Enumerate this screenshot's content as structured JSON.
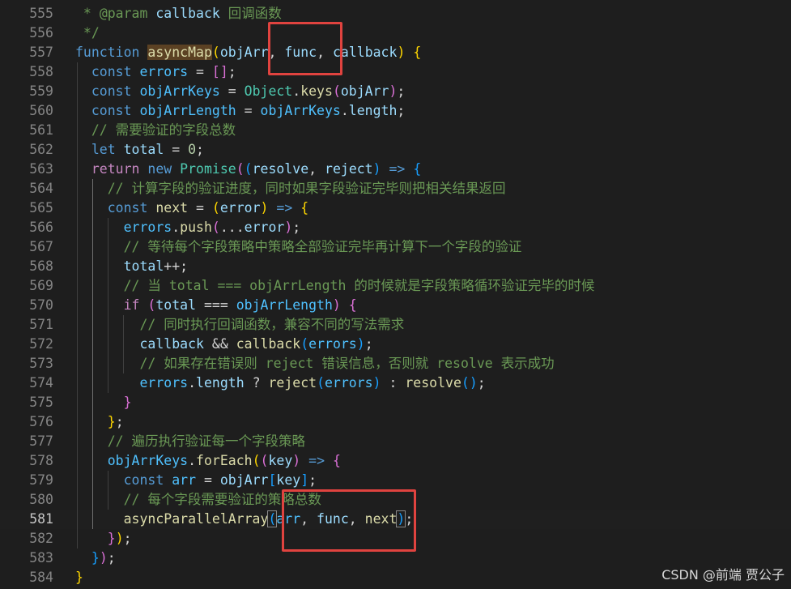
{
  "editor": {
    "lines": [
      {
        "n": "555",
        "tokens": [
          {
            "c": "cm",
            "t": " * "
          },
          {
            "c": "cm",
            "t": "@param"
          },
          {
            "c": "v",
            "t": " callback"
          },
          {
            "c": "cm",
            "t": " 回调函数"
          }
        ]
      },
      {
        "n": "556",
        "tokens": [
          {
            "c": "cm",
            "t": " */"
          }
        ]
      },
      {
        "n": "557",
        "tokens": [
          {
            "c": "k",
            "t": "function"
          },
          {
            "c": "p",
            "t": " "
          },
          {
            "c": "f hl",
            "t": "asyncMap"
          },
          {
            "c": "b1",
            "t": "("
          },
          {
            "c": "v",
            "t": "objArr"
          },
          {
            "c": "p",
            "t": ", "
          },
          {
            "c": "v",
            "t": "func"
          },
          {
            "c": "p",
            "t": ", "
          },
          {
            "c": "v",
            "t": "callback"
          },
          {
            "c": "b1",
            "t": ")"
          },
          {
            "c": "p",
            "t": " "
          },
          {
            "c": "b1",
            "t": "{"
          }
        ]
      },
      {
        "n": "558",
        "tokens": [
          {
            "c": "p",
            "t": "  "
          },
          {
            "c": "k",
            "t": "const"
          },
          {
            "c": "p",
            "t": " "
          },
          {
            "c": "cn",
            "t": "errors"
          },
          {
            "c": "p",
            "t": " = "
          },
          {
            "c": "b2",
            "t": "[]"
          },
          {
            "c": "p",
            "t": ";"
          }
        ]
      },
      {
        "n": "559",
        "tokens": [
          {
            "c": "p",
            "t": "  "
          },
          {
            "c": "k",
            "t": "const"
          },
          {
            "c": "p",
            "t": " "
          },
          {
            "c": "cn",
            "t": "objArrKeys"
          },
          {
            "c": "p",
            "t": " = "
          },
          {
            "c": "t",
            "t": "Object"
          },
          {
            "c": "p",
            "t": "."
          },
          {
            "c": "f",
            "t": "keys"
          },
          {
            "c": "b2",
            "t": "("
          },
          {
            "c": "v",
            "t": "objArr"
          },
          {
            "c": "b2",
            "t": ")"
          },
          {
            "c": "p",
            "t": ";"
          }
        ]
      },
      {
        "n": "560",
        "tokens": [
          {
            "c": "p",
            "t": "  "
          },
          {
            "c": "k",
            "t": "const"
          },
          {
            "c": "p",
            "t": " "
          },
          {
            "c": "cn",
            "t": "objArrLength"
          },
          {
            "c": "p",
            "t": " = "
          },
          {
            "c": "cn",
            "t": "objArrKeys"
          },
          {
            "c": "p",
            "t": "."
          },
          {
            "c": "v",
            "t": "length"
          },
          {
            "c": "p",
            "t": ";"
          }
        ]
      },
      {
        "n": "561",
        "tokens": [
          {
            "c": "p",
            "t": "  "
          },
          {
            "c": "cm",
            "t": "// 需要验证的字段总数"
          }
        ]
      },
      {
        "n": "562",
        "tokens": [
          {
            "c": "p",
            "t": "  "
          },
          {
            "c": "k",
            "t": "let"
          },
          {
            "c": "p",
            "t": " "
          },
          {
            "c": "v",
            "t": "total"
          },
          {
            "c": "p",
            "t": " = "
          },
          {
            "c": "n",
            "t": "0"
          },
          {
            "c": "p",
            "t": ";"
          }
        ]
      },
      {
        "n": "563",
        "tokens": [
          {
            "c": "p",
            "t": "  "
          },
          {
            "c": "c",
            "t": "return"
          },
          {
            "c": "p",
            "t": " "
          },
          {
            "c": "k",
            "t": "new"
          },
          {
            "c": "p",
            "t": " "
          },
          {
            "c": "t",
            "t": "Promise"
          },
          {
            "c": "b2",
            "t": "("
          },
          {
            "c": "b3",
            "t": "("
          },
          {
            "c": "v",
            "t": "resolve"
          },
          {
            "c": "p",
            "t": ", "
          },
          {
            "c": "v",
            "t": "reject"
          },
          {
            "c": "b3",
            "t": ")"
          },
          {
            "c": "p",
            "t": " "
          },
          {
            "c": "k",
            "t": "=>"
          },
          {
            "c": "p",
            "t": " "
          },
          {
            "c": "b3",
            "t": "{"
          }
        ]
      },
      {
        "n": "564",
        "tokens": [
          {
            "c": "p",
            "t": "    "
          },
          {
            "c": "cm",
            "t": "// 计算字段的验证进度，同时如果字段验证完毕则把相关结果返回"
          }
        ]
      },
      {
        "n": "565",
        "tokens": [
          {
            "c": "p",
            "t": "    "
          },
          {
            "c": "k",
            "t": "const"
          },
          {
            "c": "p",
            "t": " "
          },
          {
            "c": "f",
            "t": "next"
          },
          {
            "c": "p",
            "t": " = "
          },
          {
            "c": "b1",
            "t": "("
          },
          {
            "c": "v",
            "t": "error"
          },
          {
            "c": "b1",
            "t": ")"
          },
          {
            "c": "p",
            "t": " "
          },
          {
            "c": "k",
            "t": "=>"
          },
          {
            "c": "p",
            "t": " "
          },
          {
            "c": "b1",
            "t": "{"
          }
        ]
      },
      {
        "n": "566",
        "tokens": [
          {
            "c": "p",
            "t": "      "
          },
          {
            "c": "cn",
            "t": "errors"
          },
          {
            "c": "p",
            "t": "."
          },
          {
            "c": "f",
            "t": "push"
          },
          {
            "c": "b2",
            "t": "("
          },
          {
            "c": "p",
            "t": "..."
          },
          {
            "c": "v",
            "t": "error"
          },
          {
            "c": "b2",
            "t": ")"
          },
          {
            "c": "p",
            "t": ";"
          }
        ]
      },
      {
        "n": "567",
        "tokens": [
          {
            "c": "p",
            "t": "      "
          },
          {
            "c": "cm",
            "t": "// 等待每个字段策略中策略全部验证完毕再计算下一个字段的验证"
          }
        ]
      },
      {
        "n": "568",
        "tokens": [
          {
            "c": "p",
            "t": "      "
          },
          {
            "c": "v",
            "t": "total"
          },
          {
            "c": "p",
            "t": "++;"
          }
        ]
      },
      {
        "n": "569",
        "tokens": [
          {
            "c": "p",
            "t": "      "
          },
          {
            "c": "cm",
            "t": "// 当 total === objArrLength 的时候就是字段策略循环验证完毕的时候"
          }
        ]
      },
      {
        "n": "570",
        "tokens": [
          {
            "c": "p",
            "t": "      "
          },
          {
            "c": "c",
            "t": "if"
          },
          {
            "c": "p",
            "t": " "
          },
          {
            "c": "b2",
            "t": "("
          },
          {
            "c": "v",
            "t": "total"
          },
          {
            "c": "p",
            "t": " === "
          },
          {
            "c": "cn",
            "t": "objArrLength"
          },
          {
            "c": "b2",
            "t": ")"
          },
          {
            "c": "p",
            "t": " "
          },
          {
            "c": "b2",
            "t": "{"
          }
        ]
      },
      {
        "n": "571",
        "tokens": [
          {
            "c": "p",
            "t": "        "
          },
          {
            "c": "cm",
            "t": "// 同时执行回调函数，兼容不同的写法需求"
          }
        ]
      },
      {
        "n": "572",
        "tokens": [
          {
            "c": "p",
            "t": "        "
          },
          {
            "c": "v",
            "t": "callback"
          },
          {
            "c": "p",
            "t": " && "
          },
          {
            "c": "f",
            "t": "callback"
          },
          {
            "c": "b3",
            "t": "("
          },
          {
            "c": "cn",
            "t": "errors"
          },
          {
            "c": "b3",
            "t": ")"
          },
          {
            "c": "p",
            "t": ";"
          }
        ]
      },
      {
        "n": "573",
        "tokens": [
          {
            "c": "p",
            "t": "        "
          },
          {
            "c": "cm",
            "t": "// 如果存在错误则 reject 错误信息，否则就 resolve 表示成功"
          }
        ]
      },
      {
        "n": "574",
        "tokens": [
          {
            "c": "p",
            "t": "        "
          },
          {
            "c": "cn",
            "t": "errors"
          },
          {
            "c": "p",
            "t": "."
          },
          {
            "c": "v",
            "t": "length"
          },
          {
            "c": "p",
            "t": " ? "
          },
          {
            "c": "f",
            "t": "reject"
          },
          {
            "c": "b3",
            "t": "("
          },
          {
            "c": "cn",
            "t": "errors"
          },
          {
            "c": "b3",
            "t": ")"
          },
          {
            "c": "p",
            "t": " : "
          },
          {
            "c": "f",
            "t": "resolve"
          },
          {
            "c": "b3",
            "t": "()"
          },
          {
            "c": "p",
            "t": ";"
          }
        ]
      },
      {
        "n": "575",
        "tokens": [
          {
            "c": "p",
            "t": "      "
          },
          {
            "c": "b2",
            "t": "}"
          }
        ]
      },
      {
        "n": "576",
        "tokens": [
          {
            "c": "p",
            "t": "    "
          },
          {
            "c": "b1",
            "t": "}"
          },
          {
            "c": "p",
            "t": ";"
          }
        ]
      },
      {
        "n": "577",
        "tokens": [
          {
            "c": "p",
            "t": "    "
          },
          {
            "c": "cm",
            "t": "// 遍历执行验证每一个字段策略"
          }
        ]
      },
      {
        "n": "578",
        "tokens": [
          {
            "c": "p",
            "t": "    "
          },
          {
            "c": "cn",
            "t": "objArrKeys"
          },
          {
            "c": "p",
            "t": "."
          },
          {
            "c": "f",
            "t": "forEach"
          },
          {
            "c": "b1",
            "t": "("
          },
          {
            "c": "b2",
            "t": "("
          },
          {
            "c": "v",
            "t": "key"
          },
          {
            "c": "b2",
            "t": ")"
          },
          {
            "c": "p",
            "t": " "
          },
          {
            "c": "k",
            "t": "=>"
          },
          {
            "c": "p",
            "t": " "
          },
          {
            "c": "b2",
            "t": "{"
          }
        ]
      },
      {
        "n": "579",
        "tokens": [
          {
            "c": "p",
            "t": "      "
          },
          {
            "c": "k",
            "t": "const"
          },
          {
            "c": "p",
            "t": " "
          },
          {
            "c": "cn",
            "t": "arr"
          },
          {
            "c": "p",
            "t": " = "
          },
          {
            "c": "v",
            "t": "objArr"
          },
          {
            "c": "b3",
            "t": "["
          },
          {
            "c": "v",
            "t": "key"
          },
          {
            "c": "b3",
            "t": "]"
          },
          {
            "c": "p",
            "t": ";"
          }
        ]
      },
      {
        "n": "580",
        "tokens": [
          {
            "c": "p",
            "t": "      "
          },
          {
            "c": "cm",
            "t": "// 每个字段需要验证的策略总数"
          }
        ]
      },
      {
        "n": "581",
        "active": true,
        "tokens": [
          {
            "c": "p",
            "t": "      "
          },
          {
            "c": "f",
            "t": "asyncParallelArray"
          },
          {
            "c": "b3 bm",
            "t": "("
          },
          {
            "c": "cn",
            "t": "arr"
          },
          {
            "c": "p",
            "t": ", "
          },
          {
            "c": "v",
            "t": "func"
          },
          {
            "c": "p",
            "t": ", "
          },
          {
            "c": "f",
            "t": "next"
          },
          {
            "c": "b3 bm",
            "t": ")"
          },
          {
            "c": "p",
            "t": ";"
          }
        ]
      },
      {
        "n": "582",
        "tokens": [
          {
            "c": "p",
            "t": "    "
          },
          {
            "c": "b2",
            "t": "}"
          },
          {
            "c": "b1",
            "t": ")"
          },
          {
            "c": "p",
            "t": ";"
          }
        ]
      },
      {
        "n": "583",
        "tokens": [
          {
            "c": "p",
            "t": "  "
          },
          {
            "c": "b3",
            "t": "}"
          },
          {
            "c": "b2",
            "t": ")"
          },
          {
            "c": "p",
            "t": ";"
          }
        ]
      },
      {
        "n": "584",
        "tokens": [
          {
            "c": "b1",
            "t": "}"
          }
        ]
      }
    ]
  },
  "watermark": "CSDN @前端 贾公子"
}
